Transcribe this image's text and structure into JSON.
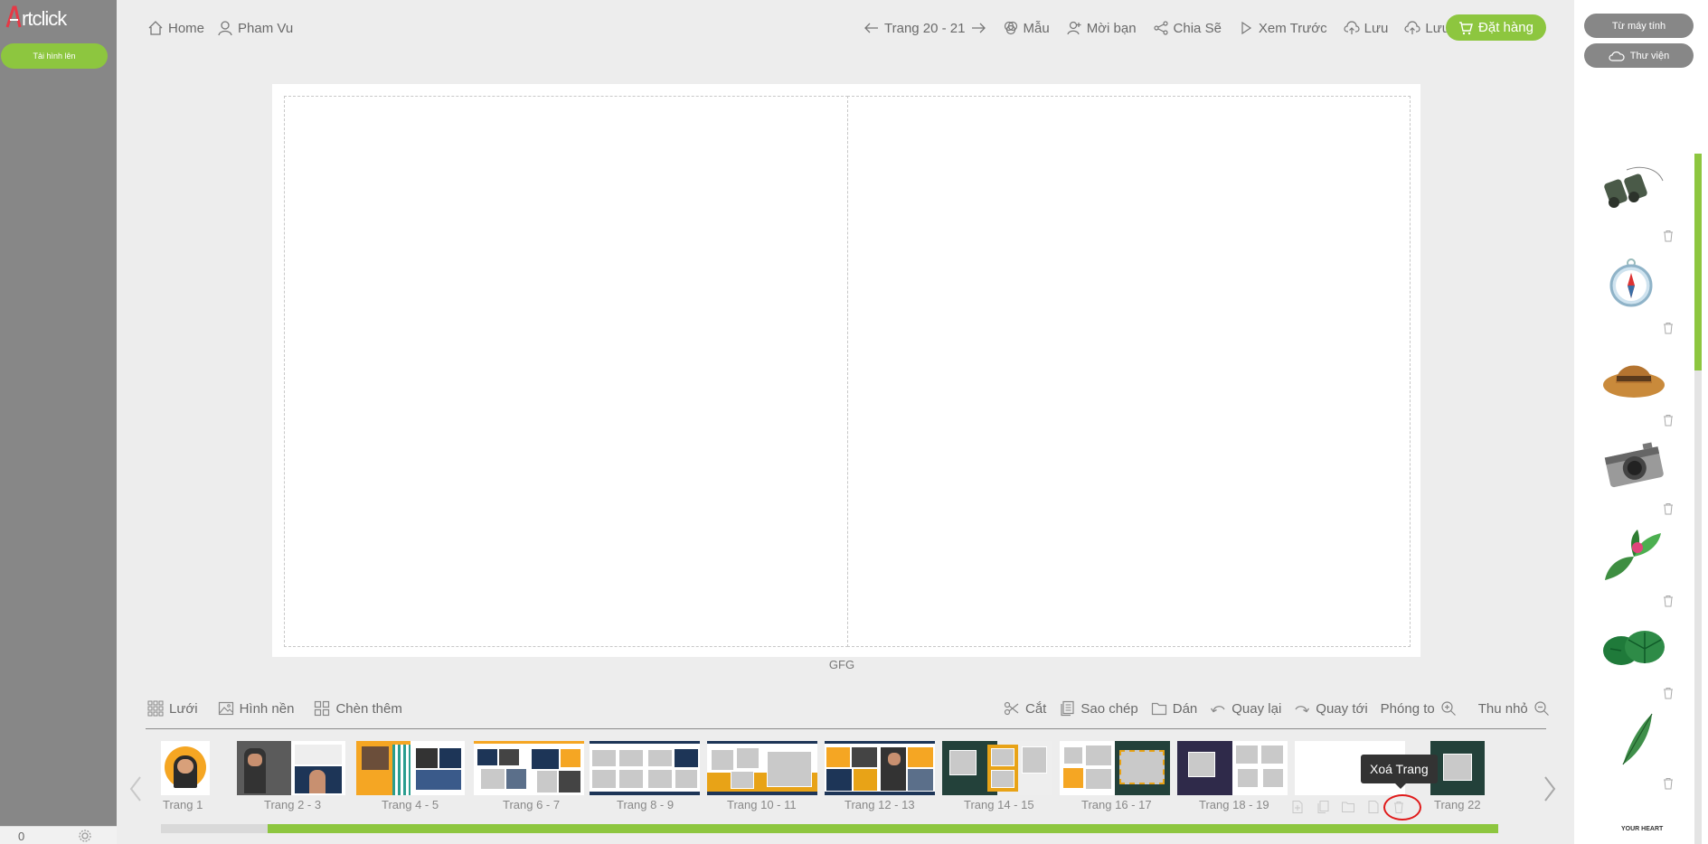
{
  "app": {
    "logo_text": "rtclick",
    "upload_button": "Tải hình lên",
    "footer_count": "0"
  },
  "topnav": {
    "home": "Home",
    "user": "Pham Vu",
    "page_nav": "Trang 20 - 21",
    "template": "Mẫu",
    "invite": "Mời bạn",
    "share": "Chia Sẽ",
    "preview": "Xem Trước",
    "save1": "Lưu",
    "save2": "Lưu",
    "order": "Đặt hàng"
  },
  "canvas": {
    "label": "GFG"
  },
  "bottom_tools": {
    "grid": "Lưới",
    "background": "Hình nền",
    "insert": "Chèn thêm",
    "cut": "Cắt",
    "copy": "Sao chép",
    "paste": "Dán",
    "undo": "Quay lại",
    "redo": "Quay tới",
    "zoom_in": "Phóng to",
    "zoom_out": "Thu nhỏ"
  },
  "thumbnails": [
    {
      "label": "Trang 1"
    },
    {
      "label": "Trang 2 - 3"
    },
    {
      "label": "Trang 4 - 5"
    },
    {
      "label": "Trang 6 - 7"
    },
    {
      "label": "Trang 8 - 9"
    },
    {
      "label": "Trang 10 - 11"
    },
    {
      "label": "Trang 12 - 13"
    },
    {
      "label": "Trang 14 - 15"
    },
    {
      "label": "Trang 16 - 17"
    },
    {
      "label": "Trang 18 - 19"
    },
    {
      "label": ""
    },
    {
      "label": "Trang 22"
    }
  ],
  "tooltip": "Xoá Trang",
  "progress": 0.92,
  "right_panel": {
    "from_computer": "Từ máy tính",
    "library": "Thư viện",
    "stickers": [
      "binoculars",
      "compass",
      "hat",
      "camera",
      "leaves-flower",
      "monstera-leaves",
      "palm-leaf"
    ],
    "footer_text": "YOUR HEART"
  },
  "colors": {
    "accent": "#8dc63f",
    "sidebar": "#878787",
    "highlight": "#e01b1b"
  }
}
